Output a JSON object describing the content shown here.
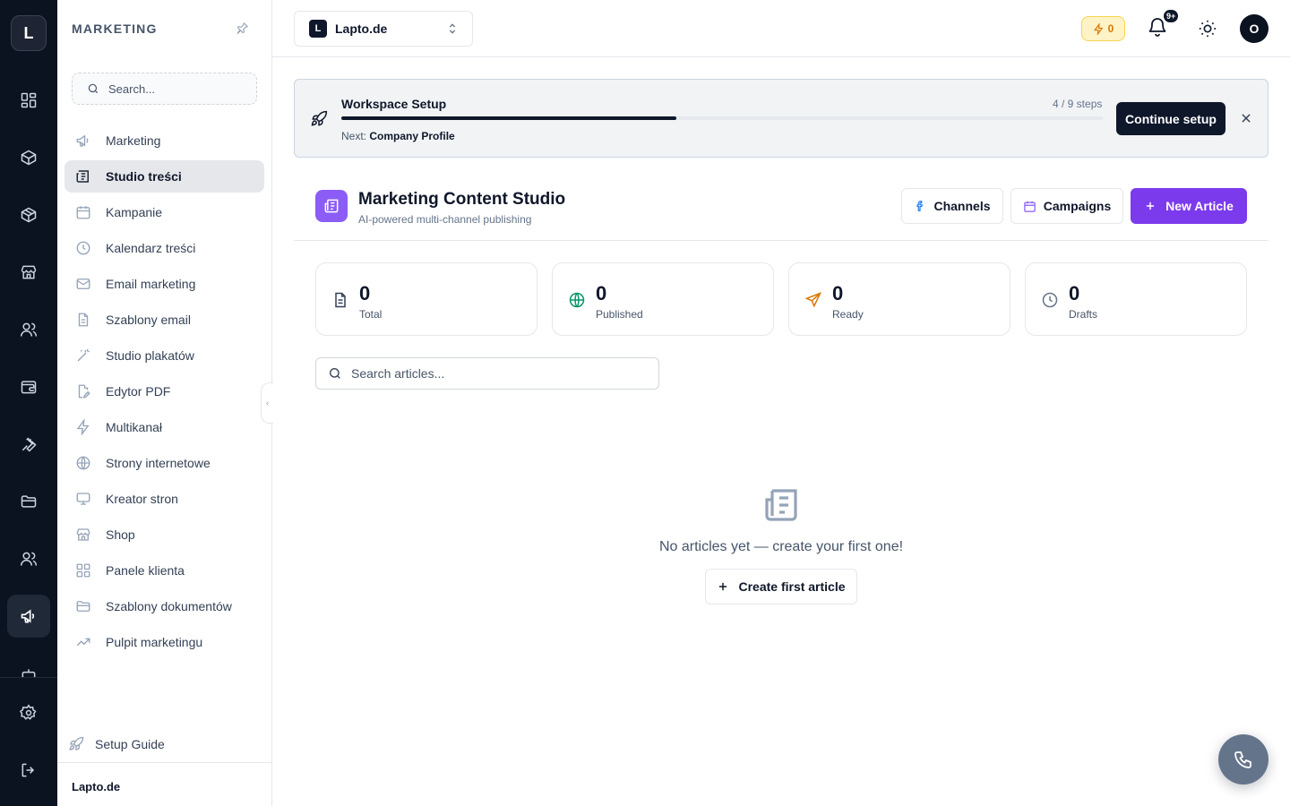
{
  "rail": {
    "logo_letter": "L",
    "items": [
      {
        "icon": "grid-icon"
      },
      {
        "icon": "box-icon"
      },
      {
        "icon": "package-icon"
      },
      {
        "icon": "store-icon"
      },
      {
        "icon": "users-icon"
      },
      {
        "icon": "wallet-icon"
      },
      {
        "icon": "wrench-icon"
      },
      {
        "icon": "folder-icon"
      },
      {
        "icon": "team-icon"
      },
      {
        "icon": "megaphone-icon",
        "active": true
      },
      {
        "icon": "bot-icon"
      },
      {
        "icon": "settings-icon"
      },
      {
        "icon": "logout-icon"
      }
    ]
  },
  "sidebar": {
    "title": "MARKETING",
    "search_placeholder": "Search...",
    "items": [
      {
        "label": "Marketing",
        "icon": "megaphone-icon"
      },
      {
        "label": "Studio treści",
        "icon": "newspaper-icon",
        "active": true
      },
      {
        "label": "Kampanie",
        "icon": "calendar-icon"
      },
      {
        "label": "Kalendarz treści",
        "icon": "clock-icon"
      },
      {
        "label": "Email marketing",
        "icon": "mail-icon"
      },
      {
        "label": "Szablony email",
        "icon": "file-text-icon"
      },
      {
        "label": "Studio plakatów",
        "icon": "wand-icon"
      },
      {
        "label": "Edytor PDF",
        "icon": "file-edit-icon"
      },
      {
        "label": "Multikanał",
        "icon": "zap-icon"
      },
      {
        "label": "Strony internetowe",
        "icon": "globe-icon"
      },
      {
        "label": "Kreator stron",
        "icon": "monitor-icon"
      },
      {
        "label": "Shop",
        "icon": "store-icon"
      },
      {
        "label": "Panele klienta",
        "icon": "grid-icon"
      },
      {
        "label": "Szablony dokumentów",
        "icon": "folder-icon"
      },
      {
        "label": "Pulpit marketingu",
        "icon": "trending-up-icon"
      }
    ],
    "setup_guide": "Setup Guide",
    "footer": "Lapto.de"
  },
  "header": {
    "workspace_badge": "L",
    "workspace_name": "Lapto.de",
    "credits": "0",
    "notifications_badge": "9+",
    "avatar_letter": "O"
  },
  "setup": {
    "title": "Workspace Setup",
    "steps_text": "4 / 9 steps",
    "progress": 0.44,
    "next_label": "Next:",
    "next_value": "Company Profile",
    "button": "Continue setup"
  },
  "studio": {
    "title": "Marketing Content Studio",
    "subtitle": "AI-powered multi-channel publishing",
    "btn_channels": "Channels",
    "btn_campaigns": "Campaigns",
    "btn_new": "New Article",
    "accent": "#7c3aed"
  },
  "stats": [
    {
      "value": "0",
      "label": "Total",
      "icon": "file-icon",
      "color": "#334155"
    },
    {
      "value": "0",
      "label": "Published",
      "icon": "globe-icon",
      "color": "#059669"
    },
    {
      "value": "0",
      "label": "Ready",
      "icon": "send-icon",
      "color": "#d97706"
    },
    {
      "value": "0",
      "label": "Drafts",
      "icon": "clock-icon",
      "color": "#64748b"
    }
  ],
  "articles": {
    "search_placeholder": "Search articles...",
    "empty_text": "No articles yet — create your first one!",
    "empty_button": "Create first article"
  }
}
